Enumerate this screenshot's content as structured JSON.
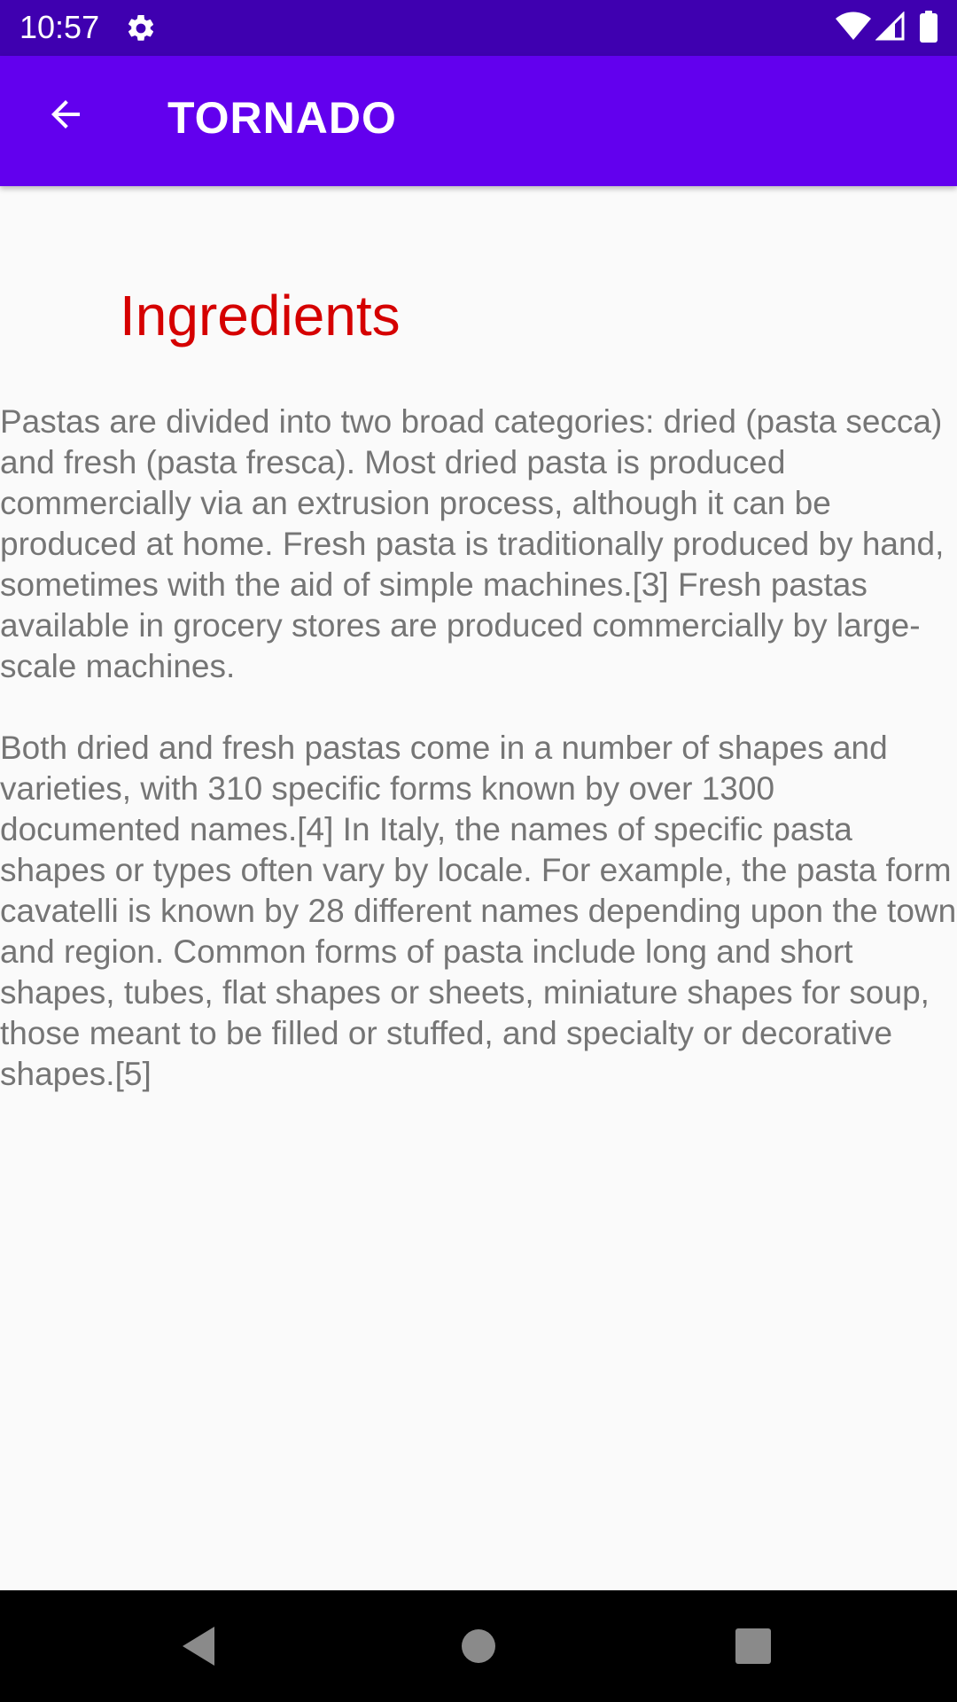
{
  "status_bar": {
    "time": "10:57",
    "icons": [
      "gear-icon",
      "wifi-icon",
      "signal-icon",
      "battery-icon"
    ]
  },
  "app_bar": {
    "title": "TORNADO",
    "back_icon": "arrow-back-icon",
    "color": "#6200ee"
  },
  "content": {
    "heading": "Ingredients",
    "heading_color": "#d50000",
    "paragraphs": [
      "Pastas are divided into two broad categories: dried (pasta secca) and fresh (pasta fresca). Most dried pasta is produced commercially via an extrusion process, although it can be produced at home. Fresh pasta is traditionally produced by hand, sometimes with the aid of simple machines.[3] Fresh pastas available in grocery stores are produced commercially by large-scale machines.",
      "Both dried and fresh pastas come in a number of shapes and varieties, with 310 specific forms known by over 1300 documented names.[4] In Italy, the names of specific pasta shapes or types often vary by locale. For example, the pasta form cavatelli is known by 28 different names depending upon the town and region. Common forms of pasta include long and short shapes, tubes, flat shapes or sheets, miniature shapes for soup, those meant to be filled or stuffed, and specialty or decorative shapes.[5]"
    ]
  },
  "nav_bar": {
    "buttons": [
      "back-triangle-icon",
      "home-circle-icon",
      "recents-square-icon"
    ]
  }
}
